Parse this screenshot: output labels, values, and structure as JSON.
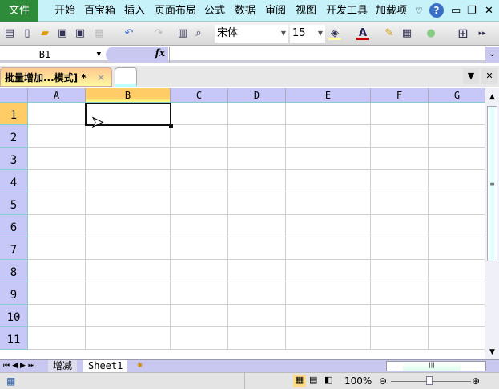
{
  "menu": {
    "file": "文件",
    "items": [
      "开始",
      "百宝箱",
      "插入",
      "页面布局",
      "公式",
      "数据",
      "审阅",
      "视图",
      "开发工具",
      "加载项"
    ]
  },
  "toolbar": {
    "font": "宋体",
    "size": "15"
  },
  "formula_bar": {
    "name_box": "B1",
    "fx": "fx",
    "value": ""
  },
  "doc_tab": {
    "title": "批量增加...模式] *"
  },
  "grid": {
    "columns": [
      "A",
      "B",
      "C",
      "D",
      "E",
      "F",
      "G"
    ],
    "rows": [
      "1",
      "2",
      "3",
      "4",
      "5",
      "6",
      "7",
      "8",
      "9",
      "10",
      "11"
    ],
    "selected_cell": "B1"
  },
  "sheets": [
    "增减",
    "Sheet1"
  ],
  "status": {
    "zoom": "100%"
  }
}
